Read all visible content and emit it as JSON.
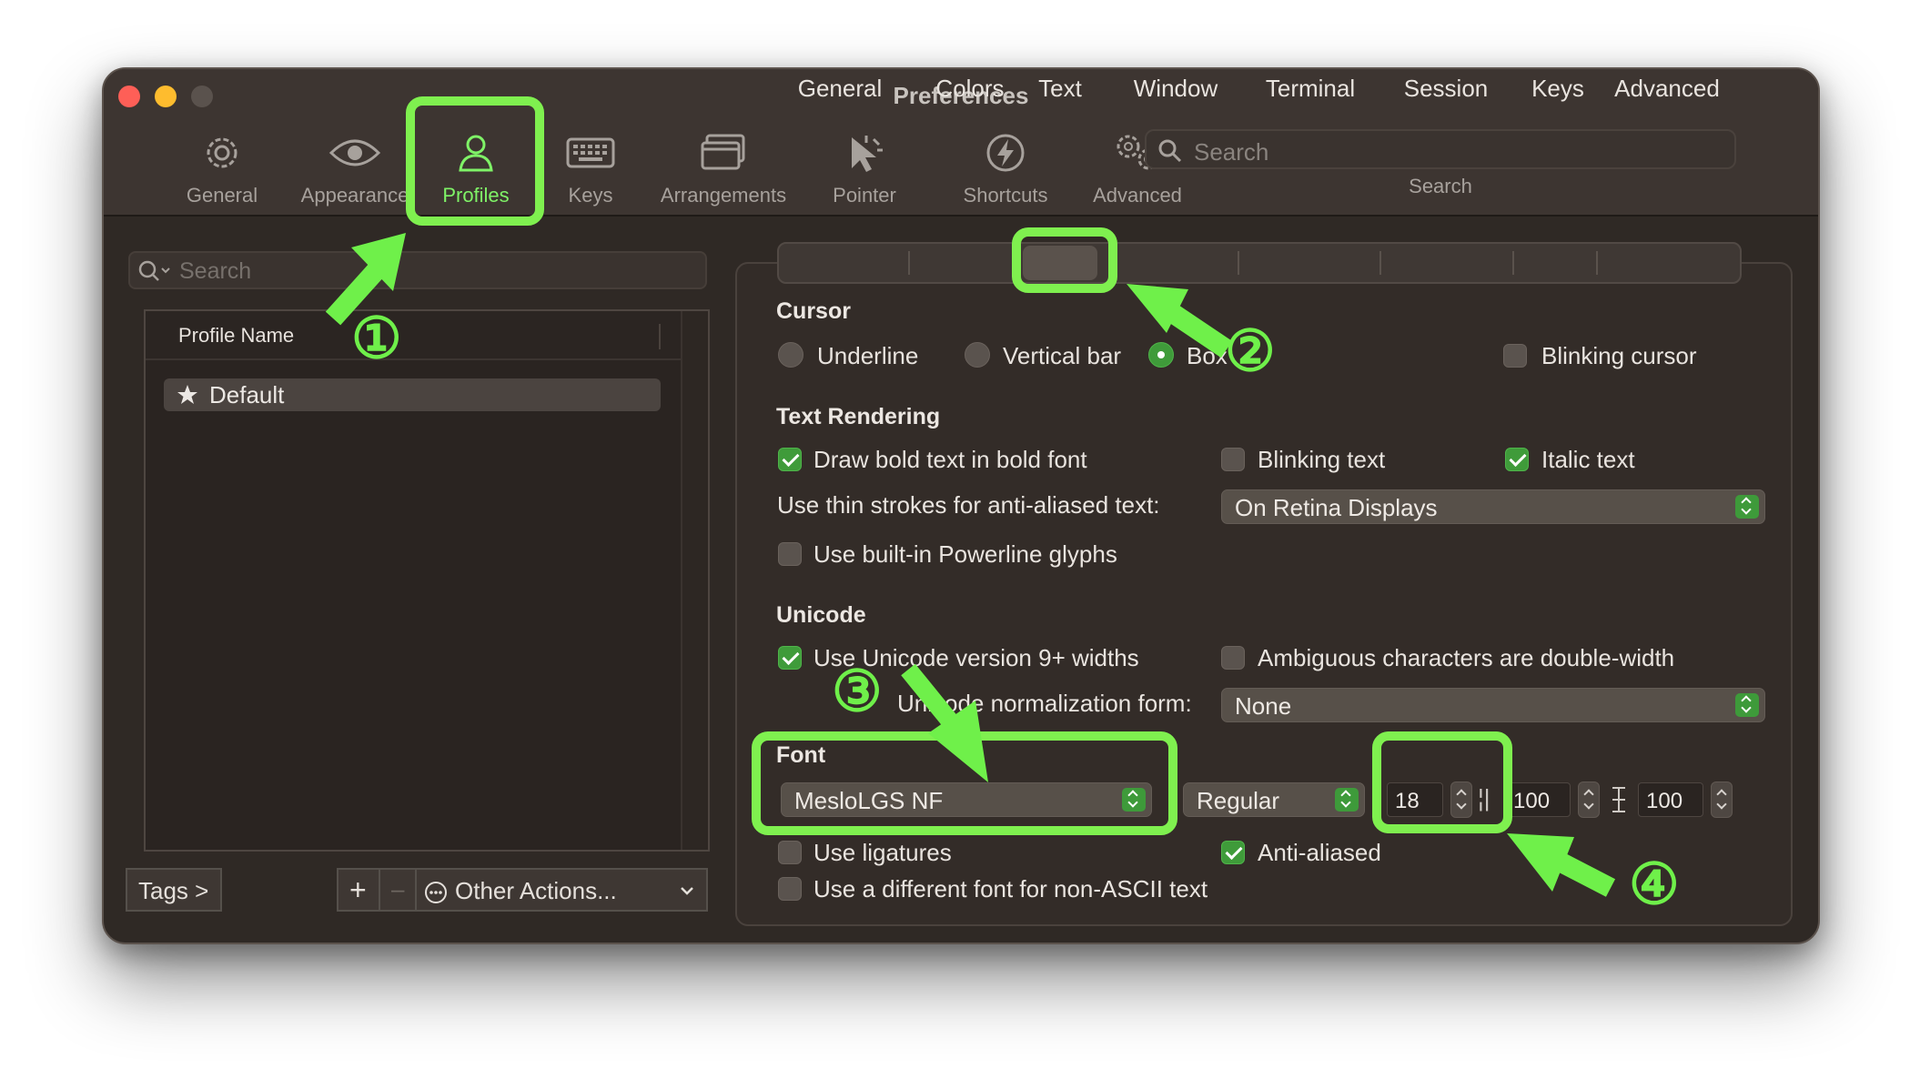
{
  "window": {
    "title": "Preferences",
    "traffic_lights": {
      "close": "#fe5f57",
      "minimize": "#febc2e",
      "zoom": "#5a524d"
    }
  },
  "toolbar": {
    "items": [
      {
        "label": "General",
        "icon": "gear-icon"
      },
      {
        "label": "Appearance",
        "icon": "eye-icon"
      },
      {
        "label": "Profiles",
        "icon": "person-icon",
        "active": true
      },
      {
        "label": "Keys",
        "icon": "keyboard-icon"
      },
      {
        "label": "Arrangements",
        "icon": "window-stack-icon"
      },
      {
        "label": "Pointer",
        "icon": "pointer-icon"
      },
      {
        "label": "Shortcuts",
        "icon": "lightning-icon"
      },
      {
        "label": "Advanced",
        "icon": "gears-icon"
      }
    ],
    "search_placeholder": "Search",
    "search_caption": "Search"
  },
  "sidebar": {
    "search_placeholder": "Search",
    "table_header": "Profile Name",
    "profiles": [
      {
        "name": "Default",
        "is_default": true
      }
    ],
    "tags_button": "Tags >",
    "add_label": "+",
    "remove_label": "–",
    "other_actions_label": "Other Actions..."
  },
  "tabs": [
    "General",
    "Colors",
    "Text",
    "Window",
    "Terminal",
    "Session",
    "Keys",
    "Advanced"
  ],
  "active_tab": "Text",
  "cursor": {
    "heading": "Cursor",
    "options": [
      "Underline",
      "Vertical bar",
      "Box"
    ],
    "selected": "Box",
    "blinking_label": "Blinking cursor",
    "blinking": false
  },
  "text_rendering": {
    "heading": "Text Rendering",
    "bold_label": "Draw bold text in bold font",
    "bold": true,
    "blinking_text_label": "Blinking text",
    "blinking_text": false,
    "italic_label": "Italic text",
    "italic": true,
    "thin_strokes_label": "Use thin strokes for anti-aliased text:",
    "thin_strokes_value": "On Retina Displays",
    "powerline_label": "Use built-in Powerline glyphs",
    "powerline": false
  },
  "unicode": {
    "heading": "Unicode",
    "v9_label": "Use Unicode version 9+ widths",
    "v9": true,
    "ambiguous_label": "Ambiguous characters are double-width",
    "ambiguous": false,
    "normalization_label": "Unicode normalization form:",
    "normalization_value": "None"
  },
  "font": {
    "heading": "Font",
    "family": "MesloLGS NF",
    "style": "Regular",
    "size": "18",
    "h_spacing": "100",
    "v_spacing": "100",
    "ligatures_label": "Use ligatures",
    "ligatures": false,
    "anti_aliased_label": "Anti-aliased",
    "anti_aliased": true,
    "non_ascii_label": "Use a different font for non-ASCII text",
    "non_ascii": false
  },
  "annotations": {
    "color": "#7ff04f",
    "markers": [
      "①",
      "②",
      "③",
      "④"
    ]
  }
}
